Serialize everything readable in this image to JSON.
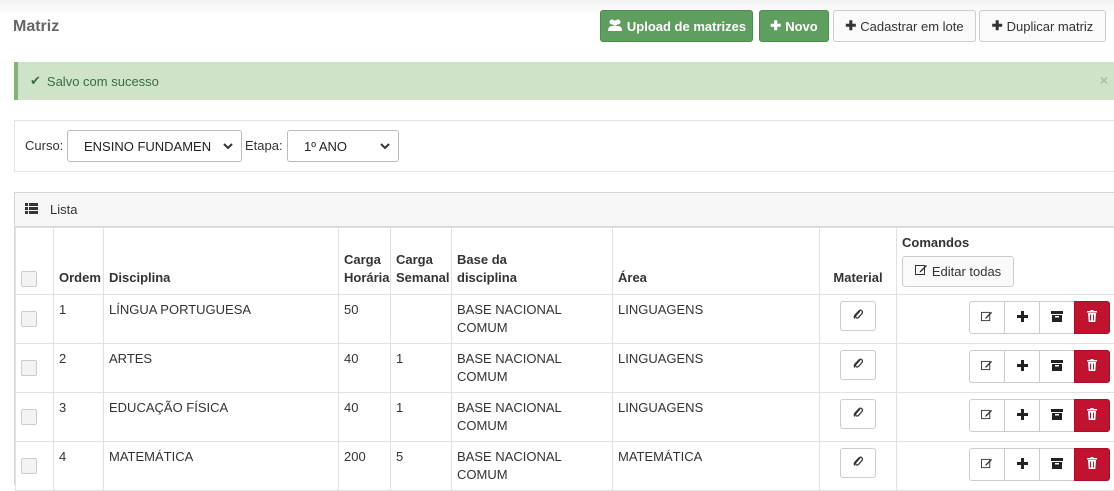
{
  "page": {
    "title": "Matriz"
  },
  "toolbar": {
    "upload_label": "Upload de matrizes",
    "new_label": "Novo",
    "batch_label": "Cadastrar em lote",
    "duplicate_label": "Duplicar matriz"
  },
  "alert": {
    "message": "Salvo com sucesso",
    "close": "×"
  },
  "filters": {
    "course_label": "Curso:",
    "course_value": "ENSINO FUNDAMEN",
    "stage_label": "Etapa:",
    "stage_value": "1º ANO"
  },
  "list": {
    "title": "Lista",
    "columns": {
      "order": "Ordem",
      "subject": "Disciplina",
      "hours_1": "Carga",
      "hours_2": "Horária",
      "weekly_1": "Carga",
      "weekly_2": "Semanal",
      "base_1": "Base da",
      "base_2": "disciplina",
      "area": "Área",
      "material": "Material",
      "commands": "Comandos",
      "edit_all": "Editar todas"
    },
    "rows": [
      {
        "order": "1",
        "subject": "LÍNGUA PORTUGUESA",
        "hours": "50",
        "weekly": "",
        "base_1": "BASE NACIONAL",
        "base_2": "COMUM",
        "area": "LINGUAGENS"
      },
      {
        "order": "2",
        "subject": "ARTES",
        "hours": "40",
        "weekly": "1",
        "base_1": "BASE NACIONAL",
        "base_2": "COMUM",
        "area": "LINGUAGENS"
      },
      {
        "order": "3",
        "subject": "EDUCAÇÃO FÍSICA",
        "hours": "40",
        "weekly": "1",
        "base_1": "BASE NACIONAL",
        "base_2": "COMUM",
        "area": "LINGUAGENS"
      },
      {
        "order": "4",
        "subject": "MATEMÁTICA",
        "hours": "200",
        "weekly": "5",
        "base_1": "BASE NACIONAL",
        "base_2": "COMUM",
        "area": "MATEMÁTICA"
      }
    ]
  },
  "colors": {
    "success_green": "#5e9e5e",
    "alert_bg": "#cfe3c8",
    "danger_red": "#c1122f"
  },
  "icons": [
    "users-icon",
    "plus-icon",
    "check-icon",
    "list-icon",
    "edit-icon",
    "paperclip-icon",
    "archive-icon",
    "trash-icon"
  ]
}
